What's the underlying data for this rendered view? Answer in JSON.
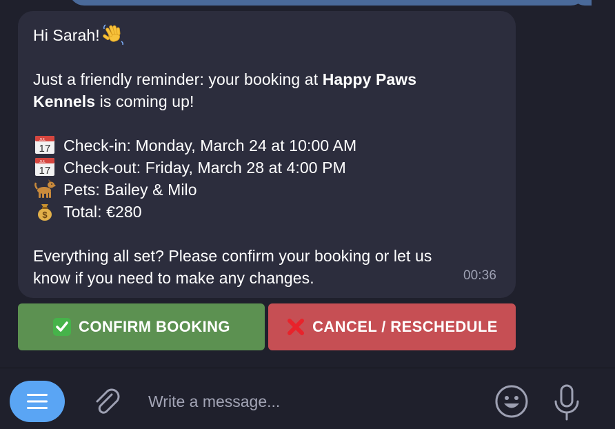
{
  "message": {
    "greeting": "Hi Sarah!",
    "reminder_prefix": "Just a friendly reminder: your booking at ",
    "business_name_line1": "Happy Paws",
    "business_name_line2": "Kennels",
    "reminder_suffix": " is coming up!",
    "details": [
      {
        "icon": "calendar-icon",
        "text": "Check-in: Monday, March 24 at 10:00 AM"
      },
      {
        "icon": "calendar-icon",
        "text": "Check-out: Friday, March 28 at 4:00 PM"
      },
      {
        "icon": "dog-icon",
        "text": "Pets: Bailey & Milo"
      },
      {
        "icon": "money-bag-icon",
        "text": "Total: €280"
      }
    ],
    "closing_line1": "Everything all set? Please confirm your booking or let us",
    "closing_line2": "know if you need to make any changes.",
    "time": "00:36"
  },
  "buttons": {
    "confirm_label": "CONFIRM BOOKING",
    "cancel_label": "CANCEL / RESCHEDULE"
  },
  "composer": {
    "placeholder": "Write a message..."
  },
  "colors": {
    "background": "#1f202c",
    "bubble": "#2c2d3d",
    "confirm": "#5c9151",
    "cancel": "#c64f54",
    "accent": "#5aa5f4"
  }
}
